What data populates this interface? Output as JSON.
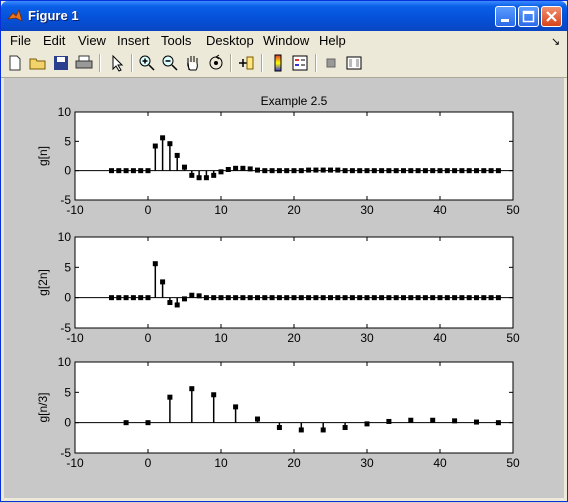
{
  "window": {
    "title": "Figure 1"
  },
  "menu": [
    "File",
    "Edit",
    "View",
    "Insert",
    "Tools",
    "Desktop",
    "Window",
    "Help"
  ],
  "dock_glyph": "↘",
  "toolbar": [
    "new-icon",
    "open-icon",
    "save-icon",
    "print-icon",
    "pointer-icon",
    "zoom-in-icon",
    "zoom-out-icon",
    "pan-icon",
    "rotate-icon",
    "data-cursor-icon",
    "colorbar-icon",
    "legend-icon",
    "hide-plot-tools-icon",
    "show-plot-tools-icon"
  ],
  "figure_title": "Example 2.5",
  "chart_data": [
    {
      "type": "stem",
      "title": "Example 2.5",
      "ylabel": "g[n]",
      "xlim": [
        -10,
        50
      ],
      "ylim": [
        -5,
        10
      ],
      "xticks": [
        -10,
        0,
        10,
        20,
        30,
        40,
        50
      ],
      "yticks": [
        -5,
        0,
        5,
        10
      ],
      "x": [
        -5,
        -4,
        -3,
        -2,
        -1,
        0,
        1,
        2,
        3,
        4,
        5,
        6,
        7,
        8,
        9,
        10,
        11,
        12,
        13,
        14,
        15,
        16,
        17,
        18,
        19,
        20,
        21,
        22,
        23,
        24,
        25,
        26,
        27,
        28,
        29,
        30,
        31,
        32,
        33,
        34,
        35,
        36,
        37,
        38,
        39,
        40,
        41,
        42,
        43,
        44,
        45,
        46,
        47,
        48
      ],
      "y": [
        0,
        0,
        0,
        0,
        0,
        0,
        4.2,
        5.6,
        4.6,
        2.6,
        0.6,
        -0.8,
        -1.2,
        -1.2,
        -0.8,
        -0.2,
        0.2,
        0.4,
        0.4,
        0.3,
        0.1,
        0,
        0,
        0,
        0,
        0,
        0,
        0.1,
        0.1,
        0.1,
        0.1,
        0.1,
        0,
        0,
        0,
        0,
        0,
        0,
        0,
        0,
        0,
        0,
        0,
        0,
        0,
        0,
        0,
        0,
        0,
        0,
        0,
        0,
        0,
        0
      ]
    },
    {
      "type": "stem",
      "ylabel": "g[2n]",
      "xlim": [
        -10,
        50
      ],
      "ylim": [
        -5,
        10
      ],
      "xticks": [
        -10,
        0,
        10,
        20,
        30,
        40,
        50
      ],
      "yticks": [
        -5,
        0,
        5,
        10
      ],
      "x": [
        -5,
        -4,
        -3,
        -2,
        -1,
        0,
        1,
        2,
        3,
        4,
        5,
        6,
        7,
        8,
        9,
        10,
        11,
        12,
        13,
        14,
        15,
        16,
        17,
        18,
        19,
        20,
        21,
        22,
        23,
        24,
        25,
        26,
        27,
        28,
        29,
        30,
        31,
        32,
        33,
        34,
        35,
        36,
        37,
        38,
        39,
        40,
        41,
        42,
        43,
        44,
        45,
        46,
        47,
        48
      ],
      "y": [
        0,
        0,
        0,
        0,
        0,
        0,
        5.6,
        2.6,
        -0.8,
        -1.2,
        -0.2,
        0.4,
        0.3,
        0,
        0,
        0,
        0,
        0,
        0,
        0,
        0,
        0,
        0,
        0,
        0,
        0,
        0,
        0,
        0,
        0,
        0,
        0,
        0,
        0,
        0,
        0,
        0,
        0,
        0,
        0,
        0,
        0,
        0,
        0,
        0,
        0,
        0,
        0,
        0,
        0,
        0,
        0,
        0,
        0
      ]
    },
    {
      "type": "stem",
      "ylabel": "g[n/3]",
      "xlim": [
        -10,
        50
      ],
      "ylim": [
        -5,
        10
      ],
      "xticks": [
        -10,
        0,
        10,
        20,
        30,
        40,
        50
      ],
      "yticks": [
        -5,
        0,
        5,
        10
      ],
      "x": [
        -3,
        0,
        3,
        6,
        9,
        12,
        15,
        18,
        21,
        24,
        27,
        30,
        33,
        36,
        39,
        42,
        45,
        48
      ],
      "y": [
        0,
        0,
        4.2,
        5.6,
        4.6,
        2.6,
        0.6,
        -0.8,
        -1.2,
        -1.2,
        -0.8,
        -0.2,
        0.2,
        0.4,
        0.4,
        0.3,
        0.1,
        0
      ]
    }
  ]
}
